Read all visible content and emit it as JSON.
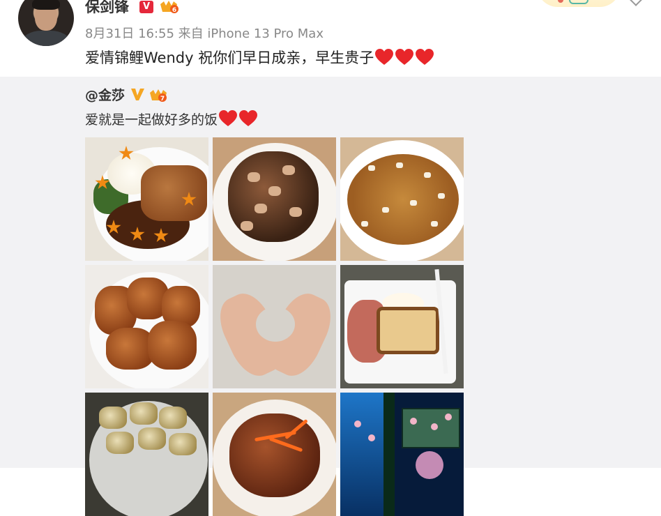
{
  "post": {
    "author": "保剑锋",
    "meta": "8月31日 16:55 来自 iPhone 13 Pro Max",
    "text": "爱情锦鲤Wendy 祝你们早日成亲，早生贵子",
    "trailing_hearts": 3,
    "verify_badge": "V",
    "level_badge": "6"
  },
  "repost": {
    "user": "@金莎",
    "level_badge": "7",
    "text": "爱就是一起做好多的饭",
    "trailing_hearts": 2,
    "photos": [
      {
        "name": "rice-pork-photo"
      },
      {
        "name": "eggplant-photo"
      },
      {
        "name": "fried-rice-photo"
      },
      {
        "name": "fried-pork-photo"
      },
      {
        "name": "heart-hands-photo"
      },
      {
        "name": "toast-breakfast-photo"
      },
      {
        "name": "fried-nuggets-photo"
      },
      {
        "name": "sweet-sour-pork-photo"
      },
      {
        "name": "aquarium-photo"
      }
    ]
  },
  "colors": {
    "heart": "#e8262a",
    "verify_red": "#e5283b",
    "verify_gold": "#f5a623",
    "repost_bg": "#f2f2f4"
  }
}
